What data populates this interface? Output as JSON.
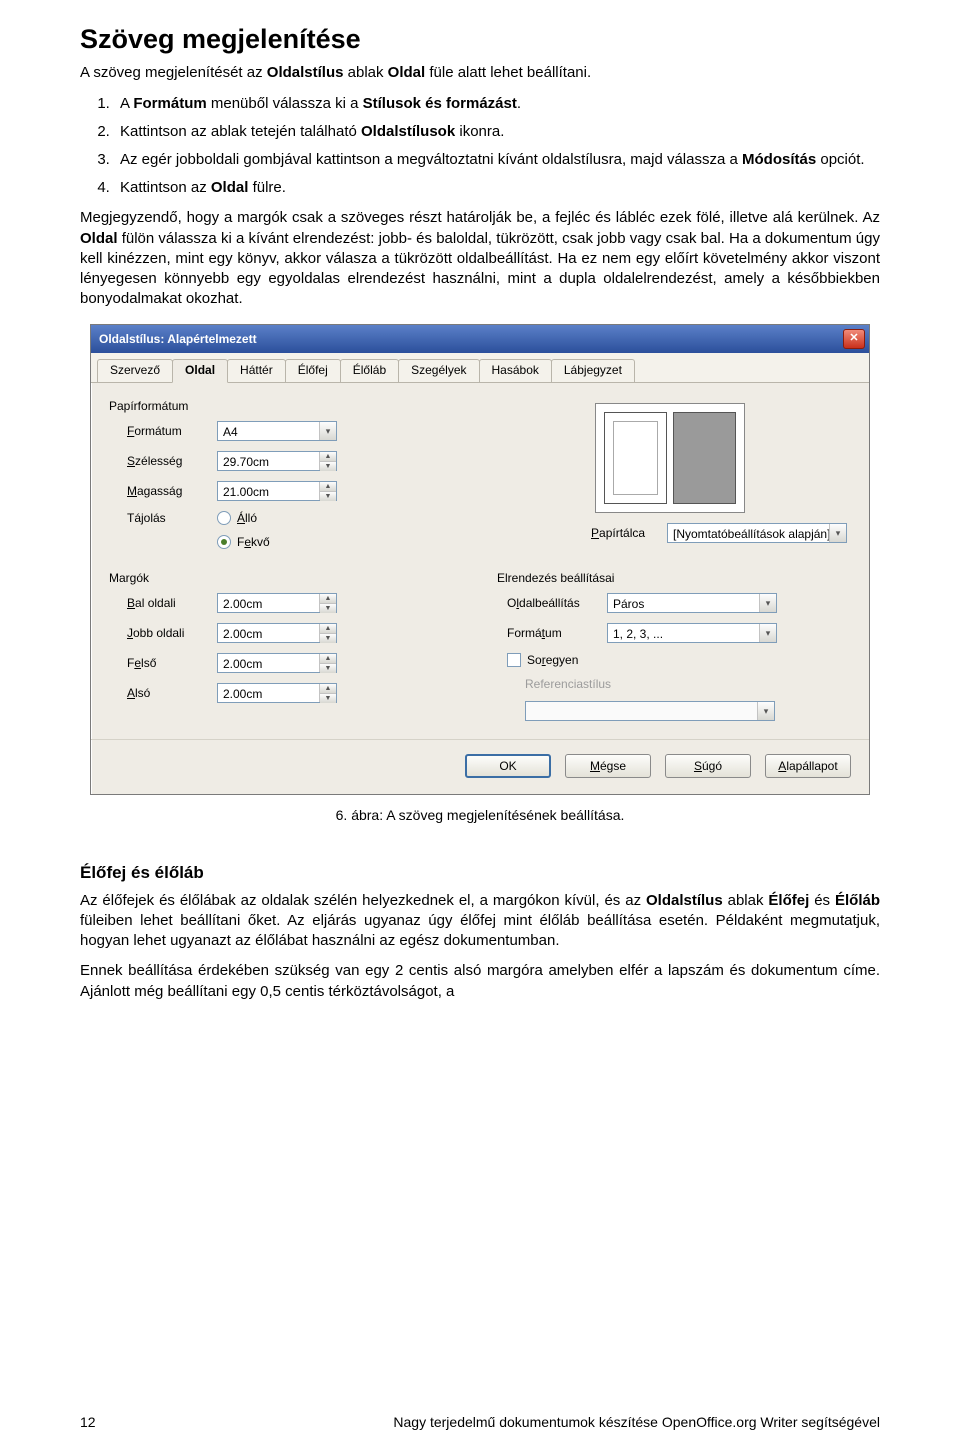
{
  "title": "Szöveg megjelenítése",
  "intro_html": "A szöveg megjelenítését az <b>Oldalstílus</b> ablak <b>Oldal</b> füle alatt lehet beállítani.",
  "steps": [
    "A <b>Formátum</b> menüből válassza ki a <b>Stílusok és formázást</b>.",
    "Kattintson az ablak tetején található <b>Oldalstílusok</b> ikonra.",
    "Az egér jobboldali gombjával kattintson a megváltoztatni kívánt oldalstílusra, majd válassza a <b>Módosítás</b> opciót.",
    "Kattintson az <b>Oldal</b> fülre."
  ],
  "note_html": "Megjegyzendő, hogy a margók csak a szöveges részt határolják be, a fejléc és lábléc ezek fölé, illetve alá kerülnek. Az <b>Oldal</b> fülön válassza ki a kívánt elrendezést: jobb- és baloldal, tükrözött, csak jobb vagy csak bal. Ha a dokumentum úgy kell kinézzen, mint egy könyv, akkor válasza a tükrözött oldalbeállítást. Ha ez nem egy előírt követelmény akkor viszont lényegesen könnyebb egy egyoldalas elrendezést használni, mint a dupla oldalelrendezést, amely a későbbiekben bonyodalmakat okozhat.",
  "dialog": {
    "title": "Oldalstílus: Alapértelmezett",
    "tabs": [
      "Szervező",
      "Oldal",
      "Háttér",
      "Élőfej",
      "Élőláb",
      "Szegélyek",
      "Hasábok",
      "Lábjegyzet"
    ],
    "active_tab": 1,
    "paper_group": "Papírformátum",
    "format_label": "Formátum",
    "format_value": "A4",
    "width_label": "Szélesség",
    "width_value": "29.70cm",
    "height_label": "Magasság",
    "height_value": "21.00cm",
    "orient_label": "Tájolás",
    "orient_portrait": "Álló",
    "orient_landscape": "Fekvő",
    "tray_label": "Papírtálca",
    "tray_value": "[Nyomtatóbeállítások alapján]",
    "margins_group": "Margók",
    "left_label": "Bal oldali",
    "right_label": "Jobb oldali",
    "top_label": "Felső",
    "bottom_label": "Alsó",
    "margin_value": "2.00cm",
    "layout_group": "Elrendezés beállításai",
    "pagelayout_label": "Oldalbeállítás",
    "pagelayout_value": "Páros",
    "numformat_label": "Formátum",
    "numformat_value": "1, 2, 3, ...",
    "register_label": "Soregyen",
    "refstyle_label": "Referenciastílus",
    "buttons": {
      "ok": "OK",
      "cancel": "Mégse",
      "help": "Súgó",
      "reset": "Alapállapot"
    }
  },
  "caption": "6. ábra: A szöveg megjelenítésének beállítása.",
  "subheading": "Élőfej és élőláb",
  "para2_html": "Az élőfejek és élőlábak az oldalak szélén helyezkednek el, a margókon kívül, és az <b>Oldalstílus</b> ablak <b>Élőfej</b> és <b>Élőláb</b> füleiben lehet beállítani őket. Az eljárás ugyanaz úgy élőfej mint élőláb beállítása esetén. Példaként megmutatjuk, hogyan lehet ugyanazt az élőlábat használni az egész dokumentumban.",
  "para3": "Ennek beállítása érdekében szükség van egy 2 centis alsó margóra amelyben elfér a lapszám és dokumentum címe. Ajánlott még beállítani egy 0,5 centis térköztávolságot, a",
  "footer": {
    "page": "12",
    "doc": "Nagy terjedelmű dokumentumok készítése OpenOffice.org Writer segítségével"
  }
}
